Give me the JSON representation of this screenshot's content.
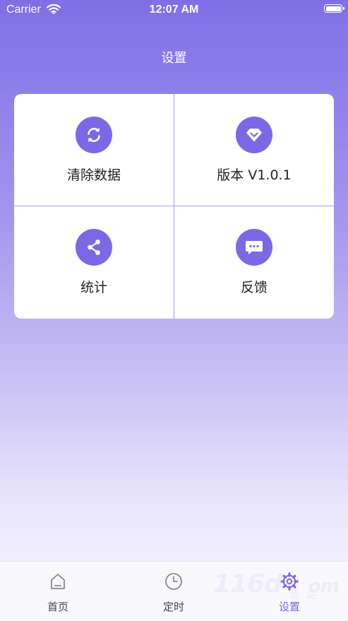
{
  "status_bar": {
    "carrier": "Carrier",
    "time": "12:07 AM"
  },
  "header": {
    "title": "设置"
  },
  "grid": {
    "items": [
      {
        "label": "清除数据",
        "icon": "refresh-icon"
      },
      {
        "label": "版本 V1.0.1",
        "icon": "diamond-icon"
      },
      {
        "label": "统计",
        "icon": "share-icon"
      },
      {
        "label": "反馈",
        "icon": "chat-bubble-icon"
      }
    ]
  },
  "tab_bar": {
    "tabs": [
      {
        "label": "首页",
        "icon": "home-icon",
        "active": false
      },
      {
        "label": "定时",
        "icon": "clock-icon",
        "active": false
      },
      {
        "label": "设置",
        "icon": "gear-icon",
        "active": true
      }
    ]
  },
  "watermark": {
    "text": "116d",
    "suffix": "om",
    "sub": "载 站"
  },
  "colors": {
    "accent": "#7b68e6",
    "gradient_top": "#7f6fe6",
    "gradient_bottom": "#f7f5fd",
    "divider": "#a79df0"
  }
}
